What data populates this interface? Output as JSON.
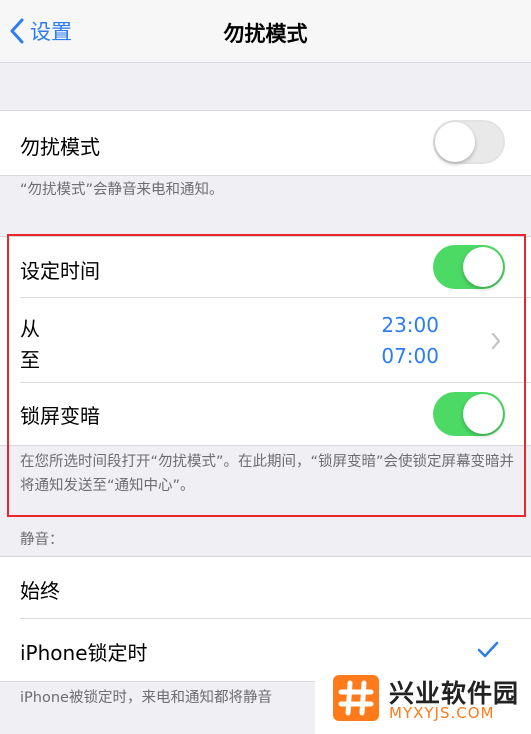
{
  "nav": {
    "back_label": "设置",
    "title": "勿扰模式"
  },
  "dnd": {
    "label": "勿扰模式",
    "enabled": false,
    "footnote": "“勿扰模式”会静音来电和通知。"
  },
  "schedule": {
    "label": "设定时间",
    "enabled": true,
    "from_label": "从",
    "to_label": "至",
    "from_time": "23:00",
    "to_time": "07:00",
    "dim_label": "锁屏变暗",
    "dim_enabled": true,
    "footnote": "在您所选时间段打开“勿扰模式”。在此期间，“锁屏变暗”会使锁定屏幕变暗并将通知发送至“通知中心”。"
  },
  "silence": {
    "header": "静音：",
    "options": [
      {
        "label": "始终",
        "selected": false
      },
      {
        "label": "iPhone锁定时",
        "selected": true
      }
    ],
    "footnote": "iPhone被锁定时，来电和通知都将静音"
  },
  "watermark": {
    "title": "兴业软件园",
    "url": "MYXYJS.COM"
  },
  "colors": {
    "accent": "#2c7cf6",
    "toggle_on": "#4cd964",
    "highlight": "#e8262b",
    "brand": "#ff7a1a"
  }
}
